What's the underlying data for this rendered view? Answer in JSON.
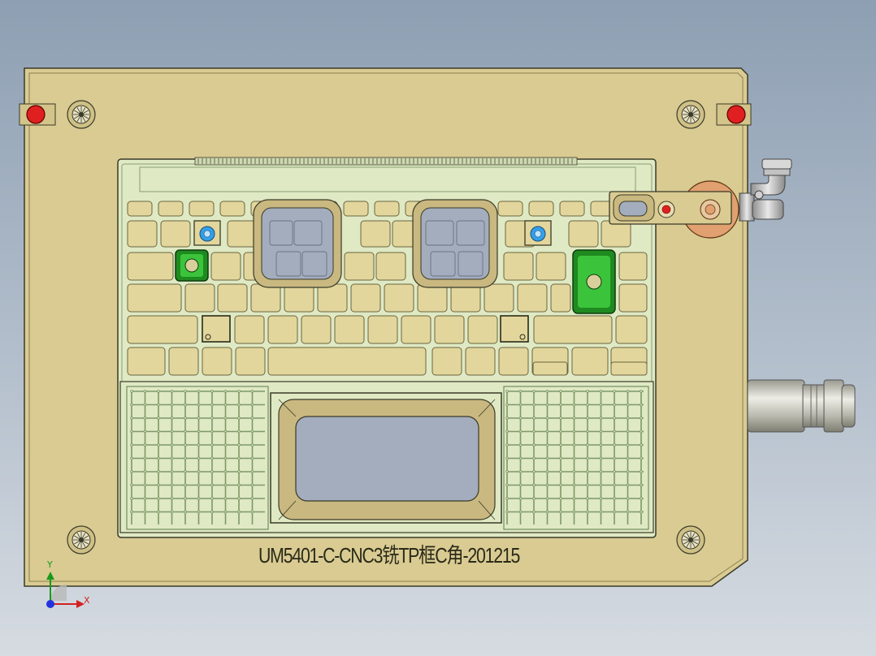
{
  "drawing": {
    "part_label": "UM5401-C-CNC3铣TP框C角-201215"
  },
  "triad": {
    "y_label": "Y",
    "x_label": "X"
  },
  "colors": {
    "background_top": "#8e9fb3",
    "plate": "#d9cb92",
    "edge": "#3a3a28",
    "pocket_fill": "#dfe9c4",
    "key_fill": "#e2d69c",
    "window_fill": "#a3adbd",
    "green_block": "#2ea82e",
    "red_pin": "#e02020",
    "blue_screw": "#33a0e8",
    "copper_clamp": "#e0a070"
  }
}
